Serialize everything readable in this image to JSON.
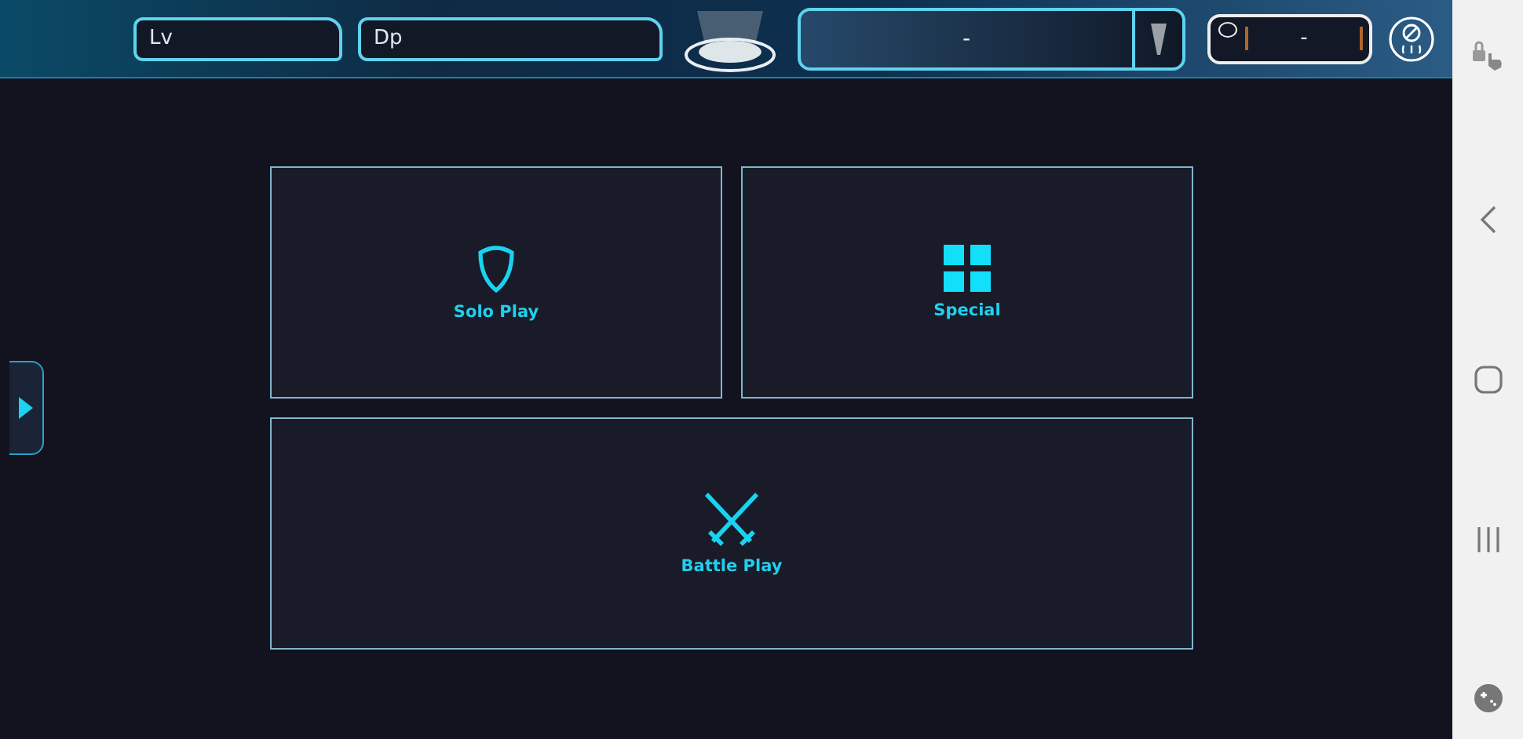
{
  "top_bar": {
    "stats": [
      {
        "label": "Lv"
      },
      {
        "label": "Dp"
      }
    ],
    "dropdown": {
      "value": "-"
    },
    "counter": {
      "value": "-"
    }
  },
  "tiles": [
    {
      "label": "Solo Play",
      "kind": "shield"
    },
    {
      "label": "Special",
      "kind": "grid"
    },
    {
      "label": "Battle Play",
      "kind": "swords"
    }
  ]
}
